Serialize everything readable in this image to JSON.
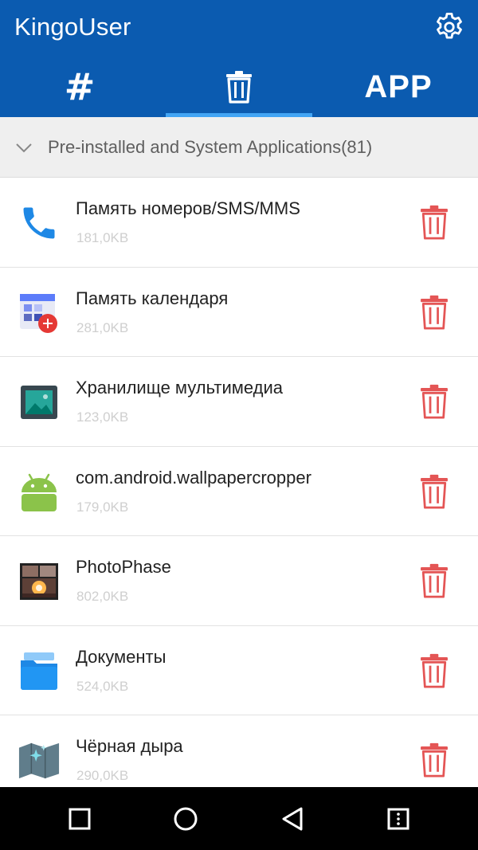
{
  "app": {
    "title": "KingoUser"
  },
  "tabs": [
    {
      "label": "#",
      "active": false
    },
    {
      "label": "trash",
      "active": true
    },
    {
      "label": "APP",
      "active": false
    }
  ],
  "section": {
    "title": "Pre-installed and System Applications(81)",
    "expanded": true
  },
  "apps": [
    {
      "name": "Память номеров/SMS/MMS",
      "size": "181,0KB",
      "icon": "phone-icon"
    },
    {
      "name": "Память календаря",
      "size": "281,0KB",
      "icon": "calendar-icon"
    },
    {
      "name": "Хранилище мультимедиа",
      "size": "123,0KB",
      "icon": "media-storage-icon"
    },
    {
      "name": "com.android.wallpapercropper",
      "size": "179,0KB",
      "icon": "android-icon"
    },
    {
      "name": "PhotoPhase",
      "size": "802,0KB",
      "icon": "photophase-icon"
    },
    {
      "name": "Документы",
      "size": "524,0KB",
      "icon": "folder-icon"
    },
    {
      "name": "Чёрная дыра",
      "size": "290,0KB",
      "icon": "map-sparkle-icon"
    }
  ],
  "colors": {
    "appbar": "#0b5bb0",
    "tab_indicator": "#42a5f5",
    "delete": "#e45555",
    "navbar": "#000000"
  },
  "navbar": {
    "buttons": [
      "recents-icon",
      "home-icon",
      "back-icon",
      "menu-icon"
    ]
  }
}
